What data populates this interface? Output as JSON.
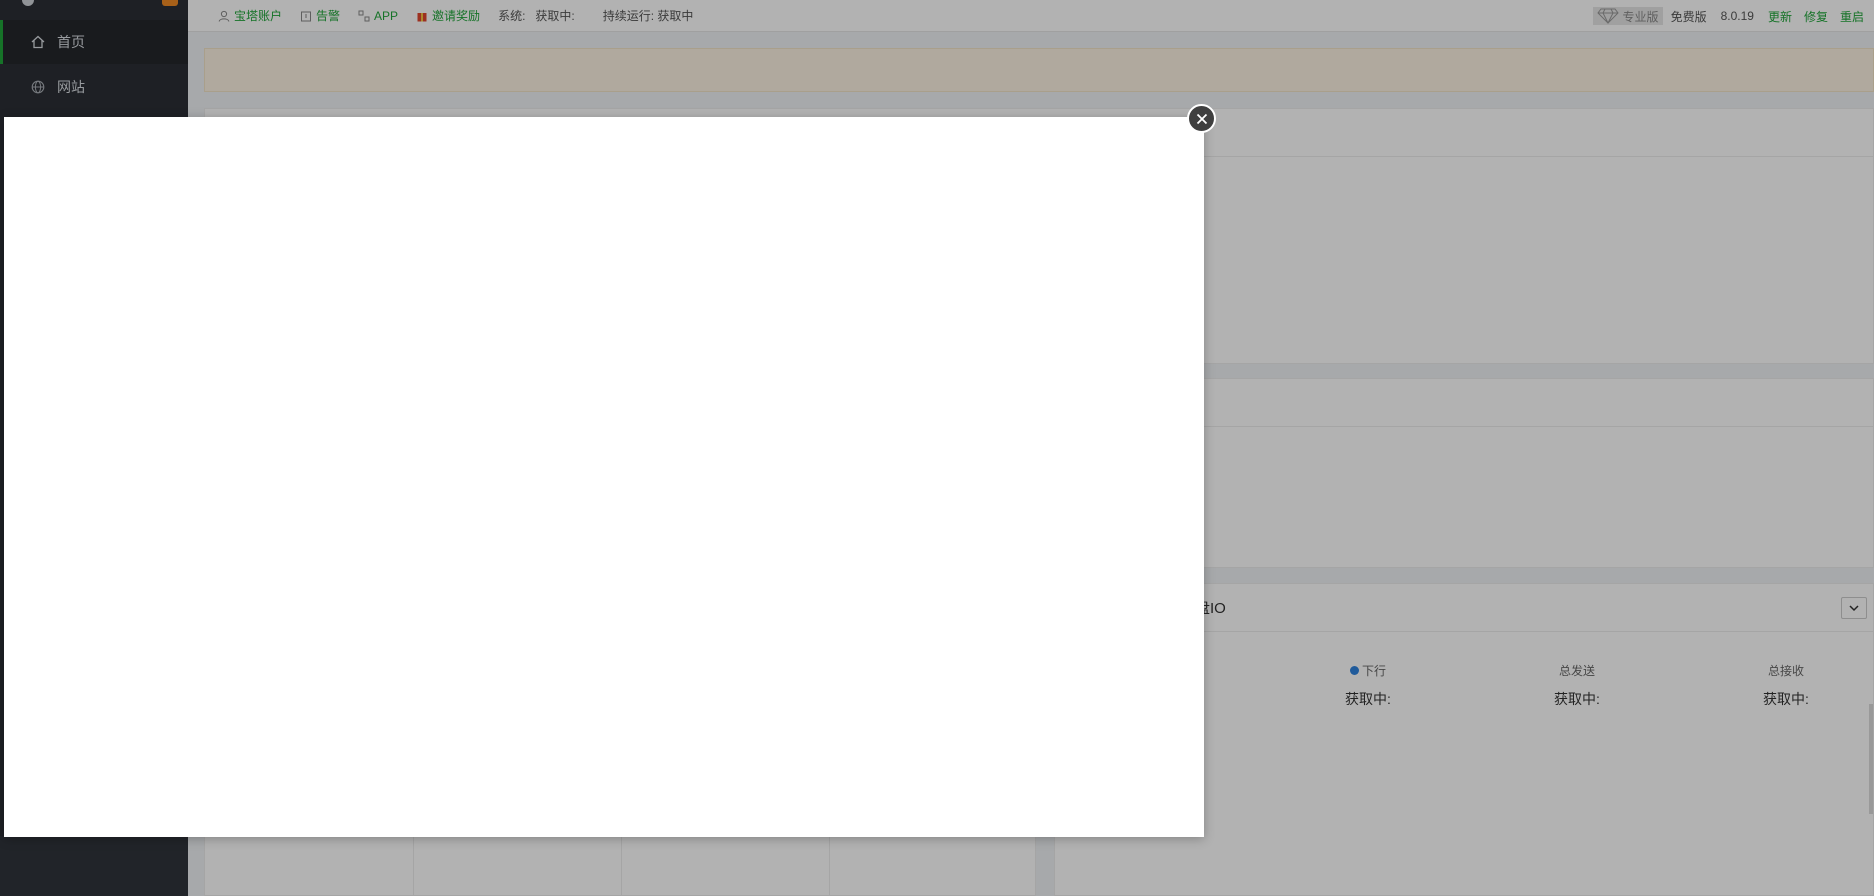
{
  "sidebar": {
    "items": [
      {
        "label": "首页",
        "icon": "home-icon",
        "active": true
      },
      {
        "label": "网站",
        "icon": "globe-icon",
        "active": false
      }
    ]
  },
  "topbar": {
    "account": "宝塔账户",
    "alarm": "告警",
    "app": "APP",
    "invite": "邀请奖励",
    "system_label": "系统:",
    "system_value": "获取中:",
    "uptime": "持续运行: 获取中",
    "pro": "专业版",
    "free": "免费版",
    "version": "8.0.19",
    "update": "更新",
    "repair": "修复",
    "restart": "重启"
  },
  "traffic_panel": {
    "title": "盘IO",
    "stats": [
      {
        "label": "下行",
        "value": "获取中:"
      },
      {
        "label": "总发送",
        "value": "获取中:"
      },
      {
        "label": "总接收",
        "value": "获取中:"
      }
    ]
  },
  "colors": {
    "accent": "#20a53a",
    "sidebar_bg": "#2b2f35",
    "downstream_dot": "#2f83df"
  }
}
